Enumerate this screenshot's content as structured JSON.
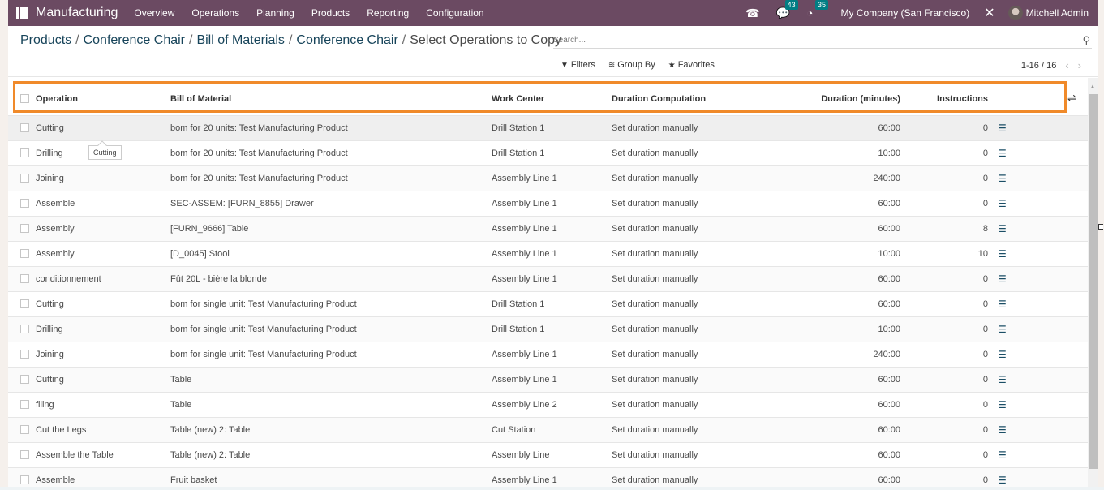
{
  "navbar": {
    "app_name": "Manufacturing",
    "menu": [
      "Overview",
      "Operations",
      "Planning",
      "Products",
      "Reporting",
      "Configuration"
    ],
    "messages_count": "43",
    "activities_count": "35",
    "company": "My Company (San Francisco)",
    "user": "Mitchell Admin"
  },
  "breadcrumb": {
    "items": [
      "Products",
      "Conference Chair",
      "Bill of Materials",
      "Conference Chair"
    ],
    "current": "Select Operations to Copy",
    "separator": "/"
  },
  "search": {
    "placeholder": "Search...",
    "value": ""
  },
  "filters": {
    "filters_label": "Filters",
    "group_by_label": "Group By",
    "favorites_label": "Favorites"
  },
  "pager": {
    "range": "1-16 / 16"
  },
  "table": {
    "columns": [
      "Operation",
      "Bill of Material",
      "Work Center",
      "Duration Computation",
      "Duration (minutes)",
      "Instructions"
    ],
    "rows": [
      {
        "operation": "Cutting",
        "bom": "bom for 20 units: Test Manufacturing Product",
        "work_center": "Drill Station 1",
        "computation": "Set duration manually",
        "duration": "60:00",
        "instructions": "0"
      },
      {
        "operation": "Drilling",
        "bom": "bom for 20 units: Test Manufacturing Product",
        "work_center": "Drill Station 1",
        "computation": "Set duration manually",
        "duration": "10:00",
        "instructions": "0"
      },
      {
        "operation": "Joining",
        "bom": "bom for 20 units: Test Manufacturing Product",
        "work_center": "Assembly Line 1",
        "computation": "Set duration manually",
        "duration": "240:00",
        "instructions": "0"
      },
      {
        "operation": "Assemble",
        "bom": "SEC-ASSEM: [FURN_8855] Drawer",
        "work_center": "Assembly Line 1",
        "computation": "Set duration manually",
        "duration": "60:00",
        "instructions": "0"
      },
      {
        "operation": "Assembly",
        "bom": "[FURN_9666] Table",
        "work_center": "Assembly Line 1",
        "computation": "Set duration manually",
        "duration": "60:00",
        "instructions": "8"
      },
      {
        "operation": "Assembly",
        "bom": "[D_0045] Stool",
        "work_center": "Assembly Line 1",
        "computation": "Set duration manually",
        "duration": "10:00",
        "instructions": "10"
      },
      {
        "operation": "conditionnement",
        "bom": "Fût 20L - bière la blonde",
        "work_center": "Assembly Line 1",
        "computation": "Set duration manually",
        "duration": "60:00",
        "instructions": "0"
      },
      {
        "operation": "Cutting",
        "bom": "bom for single unit: Test Manufacturing Product",
        "work_center": "Drill Station 1",
        "computation": "Set duration manually",
        "duration": "60:00",
        "instructions": "0"
      },
      {
        "operation": "Drilling",
        "bom": "bom for single unit: Test Manufacturing Product",
        "work_center": "Drill Station 1",
        "computation": "Set duration manually",
        "duration": "10:00",
        "instructions": "0"
      },
      {
        "operation": "Joining",
        "bom": "bom for single unit: Test Manufacturing Product",
        "work_center": "Assembly Line 1",
        "computation": "Set duration manually",
        "duration": "240:00",
        "instructions": "0"
      },
      {
        "operation": "Cutting",
        "bom": "Table",
        "work_center": "Assembly Line 1",
        "computation": "Set duration manually",
        "duration": "60:00",
        "instructions": "0"
      },
      {
        "operation": "filing",
        "bom": "Table",
        "work_center": "Assembly Line 2",
        "computation": "Set duration manually",
        "duration": "60:00",
        "instructions": "0"
      },
      {
        "operation": "Cut the Legs",
        "bom": "Table (new) 2: Table",
        "work_center": "Cut Station",
        "computation": "Set duration manually",
        "duration": "60:00",
        "instructions": "0"
      },
      {
        "operation": "Assemble the Table",
        "bom": "Table (new) 2: Table",
        "work_center": "Assembly Line",
        "computation": "Set duration manually",
        "duration": "60:00",
        "instructions": "0"
      },
      {
        "operation": "Assemble",
        "bom": "Fruit basket",
        "work_center": "Assembly Line 1",
        "computation": "Set duration manually",
        "duration": "60:00",
        "instructions": "0"
      }
    ]
  },
  "tooltip": {
    "text": "Cutting"
  },
  "colors": {
    "navbar": "#6b4a62",
    "badge": "#017e84",
    "highlight": "#f08a2a",
    "link": "#17445a"
  }
}
